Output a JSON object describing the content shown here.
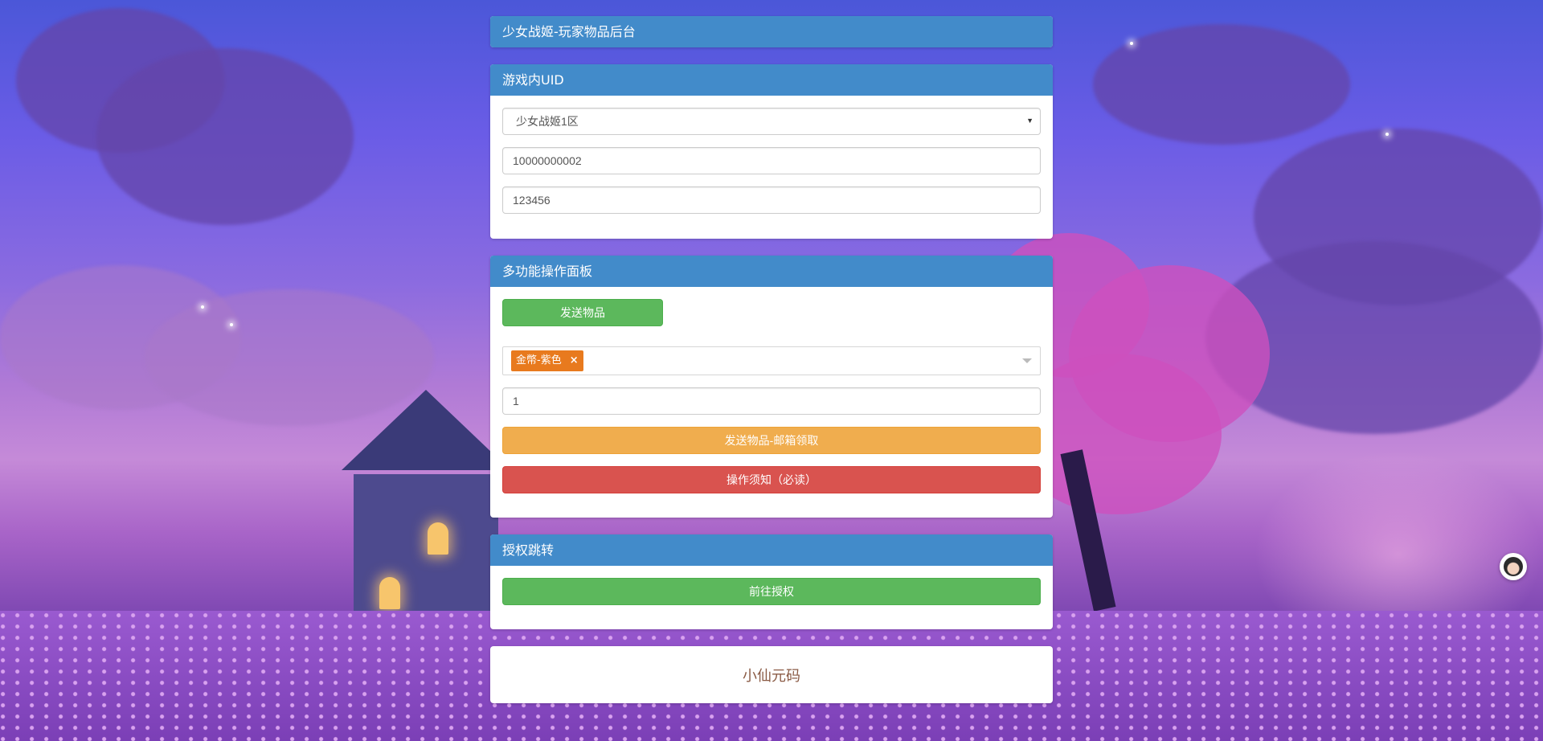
{
  "header": {
    "title": "少女战姬-玩家物品后台"
  },
  "uid_panel": {
    "title": "游戏内UID",
    "server_select": {
      "value": "少女战姬1区"
    },
    "uid_input": {
      "value": "10000000002"
    },
    "password_input": {
      "value": "123456"
    }
  },
  "ops_panel": {
    "title": "多功能操作面板",
    "send_items_label": "发送物品",
    "selected_items": [
      {
        "label": "金幣-紫色"
      }
    ],
    "quantity_input": {
      "value": "1"
    },
    "send_mail_label": "发送物品-邮箱领取",
    "notice_label": "操作须知（必读）"
  },
  "auth_panel": {
    "title": "授权跳转",
    "go_auth_label": "前往授权"
  },
  "footer": {
    "text": "小仙元码"
  },
  "colors": {
    "panel_heading": "#428bca",
    "success": "#5cb85c",
    "warning": "#f0ad4e",
    "danger": "#d9534f",
    "tag": "#e87a1e"
  }
}
